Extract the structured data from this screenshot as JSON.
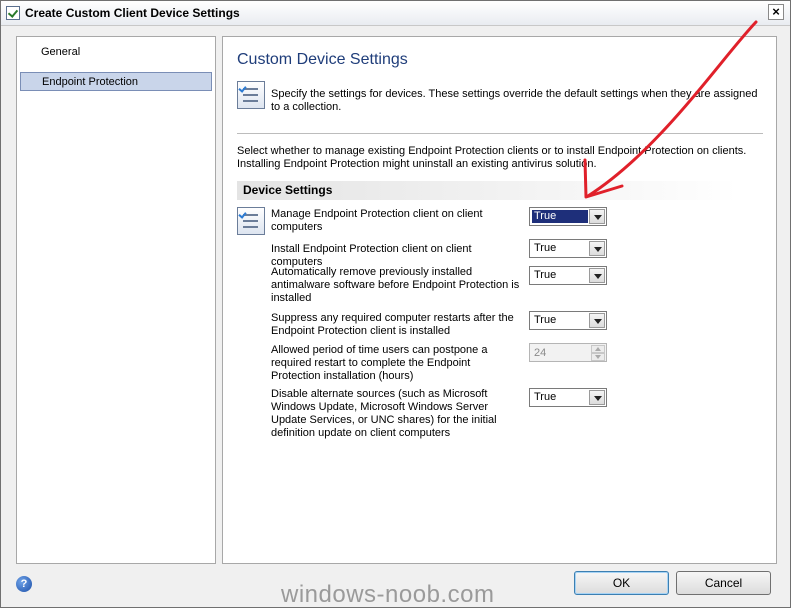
{
  "window": {
    "title": "Create Custom Client Device Settings",
    "close_glyph": "×"
  },
  "nav": {
    "items": [
      {
        "label": "General",
        "selected": false
      },
      {
        "label": "Endpoint Protection",
        "selected": true
      }
    ]
  },
  "page": {
    "title": "Custom Device Settings",
    "description": "Specify the settings for devices. These settings override the default settings when they are assigned to a collection.",
    "instructions": "Select whether to manage existing Endpoint Protection clients or to install Endpoint Protection on clients. Installing Endpoint Protection might uninstall an existing antivirus solution.",
    "section_header": "Device Settings"
  },
  "settings": [
    {
      "label": "Manage Endpoint Protection client on client computers",
      "value": "True",
      "control": "combo"
    },
    {
      "label": "Install Endpoint Protection client on client computers",
      "value": "True",
      "control": "combo"
    },
    {
      "label": "Automatically remove previously installed antimalware software before Endpoint Protection is installed",
      "value": "True",
      "control": "combo"
    },
    {
      "label": "Suppress any required computer restarts after the Endpoint Protection client is installed",
      "value": "True",
      "control": "combo"
    },
    {
      "label": "Allowed period of time users can postpone a required restart to complete the Endpoint Protection installation (hours)",
      "value": "24",
      "control": "spin-disabled"
    },
    {
      "label": "Disable alternate sources (such as Microsoft Windows Update, Microsoft Windows Server Update Services, or UNC shares) for the initial definition update on client computers",
      "value": "True",
      "control": "combo"
    }
  ],
  "footer": {
    "help_glyph": "?",
    "ok_label": "OK",
    "cancel_label": "Cancel",
    "watermark": "windows-noob.com"
  },
  "colors": {
    "title_blue": "#1f3d7a",
    "selection_blue": "#1e2f7a",
    "annotation_red": "#e0202a"
  }
}
